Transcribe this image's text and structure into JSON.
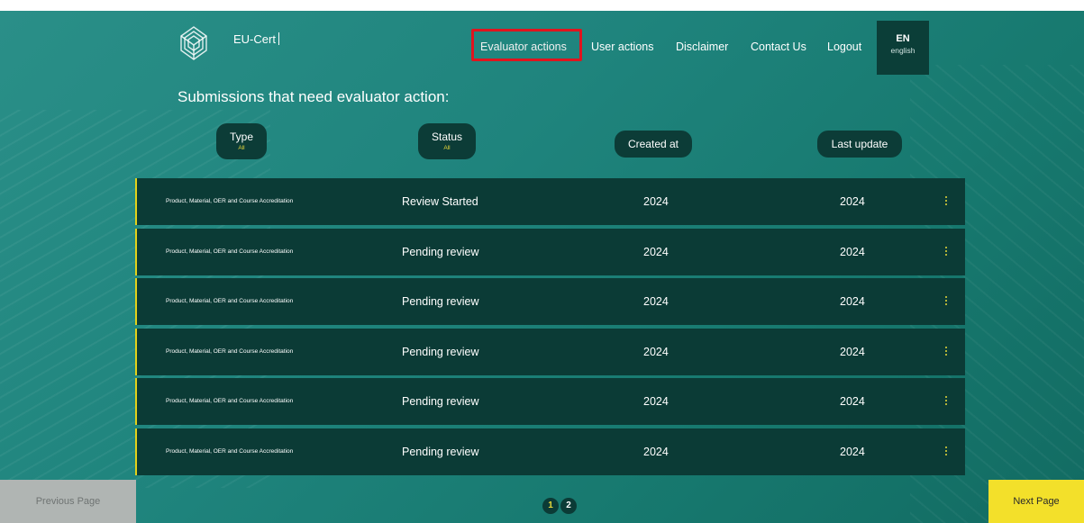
{
  "header": {
    "brand": "EU-Cert",
    "nav": {
      "evaluator_actions": "Evaluator actions",
      "user_actions": "User actions",
      "disclaimer": "Disclaimer",
      "contact_us": "Contact Us",
      "logout": "Logout"
    },
    "language": {
      "code": "EN",
      "name": "english"
    }
  },
  "section_title": "Submissions that need evaluator action:",
  "filters": {
    "type": {
      "label": "Type",
      "value": "All"
    },
    "status": {
      "label": "Status",
      "value": "All"
    },
    "created_at": {
      "label": "Created at"
    },
    "last_update": {
      "label": "Last update"
    }
  },
  "rows": [
    {
      "type": "Product, Material, OER and Course Accreditation",
      "status": "Review Started",
      "created": "2024",
      "updated": "2024"
    },
    {
      "type": "Product, Material, OER and Course Accreditation",
      "status": "Pending review",
      "created": "2024",
      "updated": "2024"
    },
    {
      "type": "Product, Material, OER and Course Accreditation",
      "status": "Pending review",
      "created": "2024",
      "updated": "2024"
    },
    {
      "type": "Product, Material, OER and Course Accreditation",
      "status": "Pending review",
      "created": "2024",
      "updated": "2024"
    },
    {
      "type": "Product, Material, OER and Course Accreditation",
      "status": "Pending review",
      "created": "2024",
      "updated": "2024"
    },
    {
      "type": "Product, Material, OER and Course Accreditation",
      "status": "Pending review",
      "created": "2024",
      "updated": "2024"
    }
  ],
  "pagination": {
    "previous_label": "Previous Page",
    "next_label": "Next Page",
    "pages": [
      "1",
      "2"
    ],
    "current": "1"
  },
  "colors": {
    "background": "#1f847d",
    "row": "#0b3b36",
    "accent_yellow": "#f3e02a",
    "highlight_red": "#e0141e"
  },
  "icons": {
    "logo": "eu-cert-logo",
    "row_menu": "kebab-menu-icon"
  }
}
